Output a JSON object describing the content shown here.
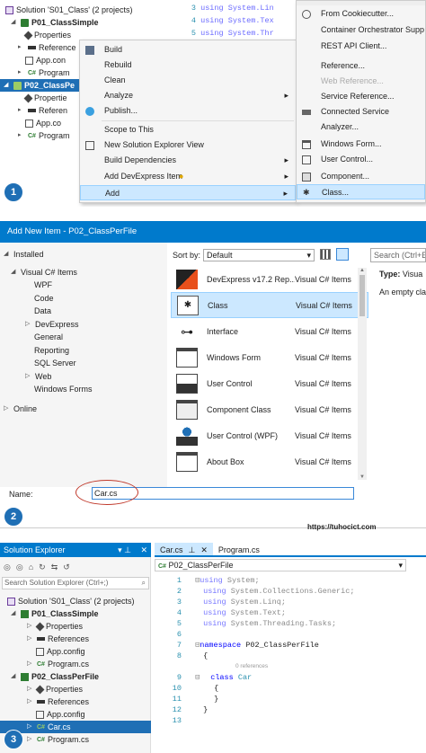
{
  "panel1": {
    "tree": [
      {
        "label": "Solution 'S01_Class' (2 projects)"
      },
      {
        "label": "P01_ClassSimple"
      },
      {
        "label": "Properties"
      },
      {
        "label": "Reference"
      },
      {
        "label": "App.con"
      },
      {
        "label": "Program"
      },
      {
        "label": "P02_ClassPe"
      },
      {
        "label": "Propertie"
      },
      {
        "label": "Referen"
      },
      {
        "label": "App.co"
      },
      {
        "label": "Program"
      }
    ],
    "code": [
      {
        "num": "3",
        "text": "using System.Lin"
      },
      {
        "num": "4",
        "text": "using System.Tex"
      },
      {
        "num": "5",
        "text": "using System.Thr"
      }
    ],
    "context_menu": [
      {
        "label": "Build"
      },
      {
        "label": "Rebuild"
      },
      {
        "label": "Clean"
      },
      {
        "label": "Analyze"
      },
      {
        "label": "Publish..."
      },
      {
        "label": "Scope to This"
      },
      {
        "label": "New Solution Explorer View"
      },
      {
        "label": "Build Dependencies"
      },
      {
        "label": "Add DevExpress Item"
      },
      {
        "label": "Add"
      }
    ],
    "submenu": [
      {
        "label": "From Cookiecutter..."
      },
      {
        "label": "Container Orchestrator Supp"
      },
      {
        "label": "REST API Client..."
      },
      {
        "label": "Reference..."
      },
      {
        "label": "Web Reference..."
      },
      {
        "label": "Service Reference..."
      },
      {
        "label": "Connected Service"
      },
      {
        "label": "Analyzer..."
      },
      {
        "label": "Windows Form..."
      },
      {
        "label": "User Control..."
      },
      {
        "label": "Component..."
      },
      {
        "label": "Class..."
      }
    ],
    "step": "1"
  },
  "dialog": {
    "title": "Add New Item - P02_ClassPerFile",
    "installed": "Installed",
    "categories": [
      {
        "label": "Visual C# Items"
      },
      {
        "label": "WPF"
      },
      {
        "label": "Code"
      },
      {
        "label": "Data"
      },
      {
        "label": "DevExpress"
      },
      {
        "label": "General"
      },
      {
        "label": "Reporting"
      },
      {
        "label": "SQL Server"
      },
      {
        "label": "Web"
      },
      {
        "label": "Windows Forms"
      }
    ],
    "online": "Online",
    "sort_label": "Sort by:",
    "sort_value": "Default",
    "search_placeholder": "Search (Ctrl+E",
    "templates": [
      {
        "name": "DevExpress v17.2 Rep...",
        "group": "Visual C# Items"
      },
      {
        "name": "Class",
        "group": "Visual C# Items"
      },
      {
        "name": "Interface",
        "group": "Visual C# Items"
      },
      {
        "name": "Windows Form",
        "group": "Visual C# Items"
      },
      {
        "name": "User Control",
        "group": "Visual C# Items"
      },
      {
        "name": "Component Class",
        "group": "Visual C# Items"
      },
      {
        "name": "User Control (WPF)",
        "group": "Visual C# Items"
      },
      {
        "name": "About Box",
        "group": "Visual C# Items"
      }
    ],
    "type_label": "Type:",
    "type_value": "Visua",
    "description": "An empty cla",
    "name_label": "Name:",
    "name_value": "Car.cs",
    "step": "2"
  },
  "watermark": "https://tuhocict.com",
  "panel3": {
    "explorer_title": "Solution Explorer",
    "search_placeholder": "Search Solution Explorer (Ctrl+;)",
    "tree": [
      {
        "label": "Solution 'S01_Class' (2 projects)"
      },
      {
        "label": "P01_ClassSimple"
      },
      {
        "label": "Properties"
      },
      {
        "label": "References"
      },
      {
        "label": "App.config"
      },
      {
        "label": "Program.cs"
      },
      {
        "label": "P02_ClassPerFile"
      },
      {
        "label": "Properties"
      },
      {
        "label": "References"
      },
      {
        "label": "App.config"
      },
      {
        "label": "Car.cs"
      },
      {
        "label": "Program.cs"
      }
    ],
    "tabs": [
      {
        "label": "Car.cs"
      },
      {
        "label": "Program.cs"
      }
    ],
    "nav_dropdown": "P02_ClassPerFile",
    "code_lines": [
      {
        "num": "1",
        "kw": "using",
        "rest": " System;"
      },
      {
        "num": "2",
        "kw": "using",
        "rest": " System.Collections.Generic;"
      },
      {
        "num": "3",
        "kw": "using",
        "rest": " System.Linq;"
      },
      {
        "num": "4",
        "kw": "using",
        "rest": " System.Text;"
      },
      {
        "num": "5",
        "kw": "using",
        "rest": " System.Threading.Tasks;"
      },
      {
        "num": "6",
        "kw": "",
        "rest": ""
      },
      {
        "num": "7",
        "kw": "namespace",
        "rest": " P02_ClassPerFile"
      },
      {
        "num": "8",
        "kw": "",
        "rest": "{"
      },
      {
        "num": "9",
        "kw": "class",
        "rest": " Car"
      },
      {
        "num": "10",
        "kw": "",
        "rest": "{"
      },
      {
        "num": "11",
        "kw": "",
        "rest": "}"
      },
      {
        "num": "12",
        "kw": "",
        "rest": "}"
      },
      {
        "num": "13",
        "kw": "",
        "rest": ""
      }
    ],
    "references_hint": "0 references",
    "step": "3"
  },
  "colors": {
    "accent": "#1f6fb5",
    "selection": "#cce8ff",
    "vs_blue": "#007acc",
    "keyword": "#0000ff",
    "type": "#2b91af"
  }
}
